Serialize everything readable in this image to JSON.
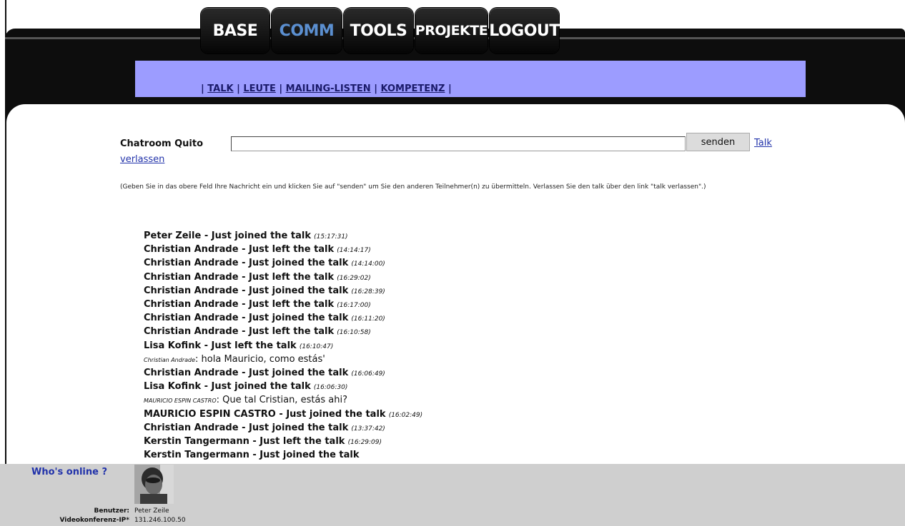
{
  "nav": {
    "tabs": [
      {
        "label": "BASE",
        "active": false
      },
      {
        "label": "COMM",
        "active": true
      },
      {
        "label": "TOOLS",
        "active": false
      },
      {
        "label": "PROJEKTE",
        "active": false
      },
      {
        "label": "LOGOUT",
        "active": false
      }
    ],
    "active_color": "#5b8fd0"
  },
  "subnav": {
    "separator": "|",
    "links": [
      "TALK",
      "LEUTE",
      "MAILING-LISTEN",
      "KOMPETENZ"
    ],
    "bg_color": "#9c9cff"
  },
  "chat": {
    "label": "Chatroom Quito",
    "input_value": "",
    "send_label": "senden",
    "leave_part1": "Talk",
    "leave_part2": "verlassen",
    "instructions": "(Geben Sie in das obere Feld Ihre Nachricht ein und klicken Sie auf \"senden\" um Sie den anderen Teilnehmer(n) zu übermitteln. Verlassen Sie den talk über den link \"talk verlassen\".)"
  },
  "messages": [
    {
      "type": "event",
      "name": "Peter Zeile",
      "text": "Just joined the talk",
      "time": "(15:17:31)"
    },
    {
      "type": "event",
      "name": "Christian Andrade",
      "text": "Just left the talk",
      "time": "(14:14:17)"
    },
    {
      "type": "event",
      "name": "Christian Andrade",
      "text": "Just joined the talk",
      "time": "(14:14:00)"
    },
    {
      "type": "event",
      "name": "Christian Andrade",
      "text": "Just left the talk",
      "time": "(16:29:02)"
    },
    {
      "type": "event",
      "name": "Christian Andrade",
      "text": "Just joined the talk",
      "time": "(16:28:39)"
    },
    {
      "type": "event",
      "name": "Christian Andrade",
      "text": "Just left the talk",
      "time": "(16:17:00)"
    },
    {
      "type": "event",
      "name": "Christian Andrade",
      "text": "Just joined the talk",
      "time": "(16:11:20)"
    },
    {
      "type": "event",
      "name": "Christian Andrade",
      "text": "Just left the talk",
      "time": "(16:10:58)"
    },
    {
      "type": "event",
      "name": "Lisa Kofink",
      "text": "Just left the talk",
      "time": "(16:10:47)"
    },
    {
      "type": "chat",
      "speaker": "Christian Andrade",
      "text": "hola Mauricio, como estás'"
    },
    {
      "type": "event",
      "name": "Christian Andrade",
      "text": "Just joined the talk",
      "time": "(16:06:49)"
    },
    {
      "type": "event",
      "name": "Lisa Kofink",
      "text": "Just joined the talk",
      "time": "(16:06:30)"
    },
    {
      "type": "chat",
      "speaker": "MAURICIO ESPIN CASTRO",
      "text": "Que tal Cristian, estás ahi?"
    },
    {
      "type": "event",
      "name": "MAURICIO ESPIN CASTRO",
      "text": "Just joined the talk",
      "time": "(16:02:49)"
    },
    {
      "type": "event",
      "name": "Christian Andrade",
      "text": "Just joined the talk",
      "time": "(13:37:42)"
    },
    {
      "type": "event",
      "name": "Kerstin Tangermann",
      "text": "Just left the talk",
      "time": "(16:29:09)"
    },
    {
      "type": "event",
      "name": "Kerstin Tangermann",
      "text": "Just joined the talk",
      "time": ""
    }
  ],
  "footer": {
    "whos_online": "Who's online ?",
    "user_label": "Benutzer:",
    "user_value": "Peter Zeile",
    "video_label": "Videokonferenz-IP*",
    "video_value": "131.246.100.50"
  }
}
